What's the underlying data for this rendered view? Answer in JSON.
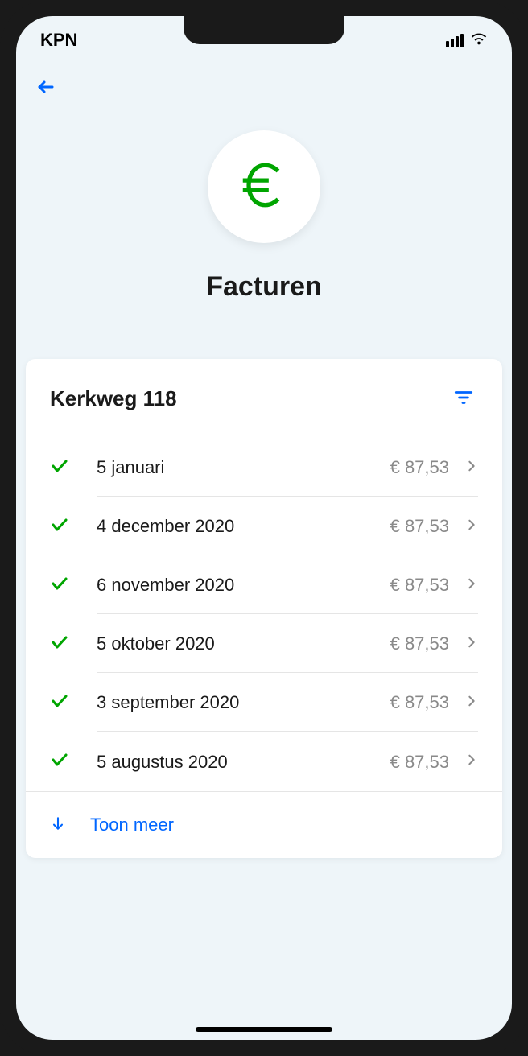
{
  "statusBar": {
    "carrier": "KPN"
  },
  "header": {
    "title": "Facturen"
  },
  "card": {
    "title": "Kerkweg 118",
    "showMore": "Toon meer"
  },
  "invoices": [
    {
      "date": "5 januari",
      "amount": "€ 87,53"
    },
    {
      "date": "4 december 2020",
      "amount": "€ 87,53"
    },
    {
      "date": "6 november 2020",
      "amount": "€ 87,53"
    },
    {
      "date": "5 oktober 2020",
      "amount": "€ 87,53"
    },
    {
      "date": "3 september 2020",
      "amount": "€ 87,53"
    },
    {
      "date": "5 augustus 2020",
      "amount": "€ 87,53"
    }
  ]
}
